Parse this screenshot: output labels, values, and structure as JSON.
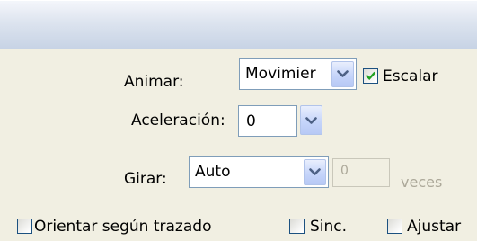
{
  "motion_tween": {
    "animate": {
      "label": "Animar:",
      "value": "Movimier"
    },
    "scale": {
      "label": "Escalar",
      "checked": true
    },
    "easing": {
      "label": "Aceleración:",
      "value": "0"
    },
    "rotate": {
      "label": "Girar:",
      "value": "Auto",
      "times_value": "0",
      "times_label": "veces"
    },
    "orient_to_path": {
      "label": "Orientar según trazado",
      "checked": false
    },
    "sync": {
      "label": "Sinc.",
      "checked": false
    },
    "snap": {
      "label": "Ajustar",
      "checked": false
    }
  },
  "colors": {
    "panel_background": "#f1efe2",
    "field_border": "#7f9db9",
    "disabled_text": "#aca899",
    "checkmark": "#21a121"
  },
  "icons": {
    "dropdown": "chevron-down-icon",
    "check": "checkmark-icon"
  }
}
